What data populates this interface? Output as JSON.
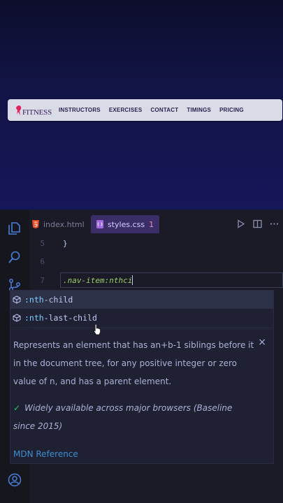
{
  "preview": {
    "logo_text": "FITNESS",
    "nav_links": [
      "INSTRUCTORS",
      "EXERCISES",
      "CONTACT",
      "TIMINGS",
      "PRICING"
    ]
  },
  "editor": {
    "tabs": [
      {
        "label": "index.html",
        "icon": "html-file-icon"
      },
      {
        "label": "styles.css",
        "icon": "css-file-icon",
        "badge": "1"
      }
    ],
    "lines": [
      {
        "number": "5",
        "text": "}"
      },
      {
        "number": "6",
        "text": ""
      },
      {
        "number": "7",
        "selector": ".nav-item",
        "pseudo": ":nthci"
      }
    ],
    "suggestions": [
      {
        "match": ":nth",
        "rest": "-child"
      },
      {
        "match": ":nth",
        "rest": "-last-child"
      }
    ],
    "docs": {
      "description": "Represents an element that has an+b-1 siblings before it in the document tree, for any positive integer or zero value of n, and has a parent element.",
      "compat": "Widely available across major browsers (Baseline since 2015)",
      "link": "MDN Reference",
      "close": "×"
    }
  },
  "colors": {
    "accent_tab": "#3b2d68",
    "link": "#3d8fd1",
    "check": "#2fbf71",
    "selector": "#9ece6a"
  }
}
